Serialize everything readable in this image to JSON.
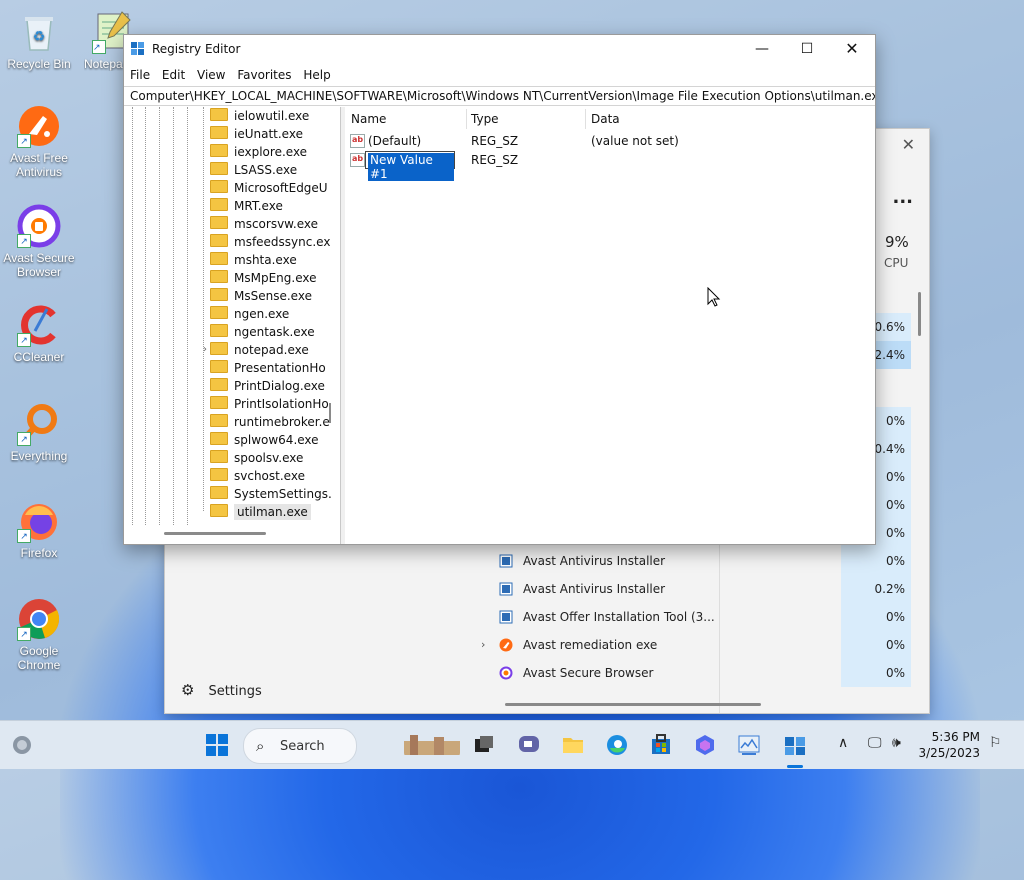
{
  "desktop": {
    "icons": [
      {
        "label": "Recycle Bin",
        "icon": "recycle-bin-icon"
      },
      {
        "label": "Notepa",
        "icon": "notepad-icon"
      },
      {
        "label": "Avast Free Antivirus",
        "icon": "avast-antivirus-icon"
      },
      {
        "label": "Avast Secure Browser",
        "icon": "avast-browser-icon"
      },
      {
        "label": "CCleaner",
        "icon": "ccleaner-icon"
      },
      {
        "label": "Everything",
        "icon": "everything-icon"
      },
      {
        "label": "Firefox",
        "icon": "firefox-icon"
      },
      {
        "label": "Google Chrome",
        "icon": "chrome-icon"
      }
    ]
  },
  "regedit": {
    "title": "Registry Editor",
    "menu": [
      "File",
      "Edit",
      "View",
      "Favorites",
      "Help"
    ],
    "address": "Computer\\HKEY_LOCAL_MACHINE\\SOFTWARE\\Microsoft\\Windows NT\\CurrentVersion\\Image File Execution Options\\utilman.exe",
    "tree": [
      "ielowutil.exe",
      "ieUnatt.exe",
      "iexplore.exe",
      "LSASS.exe",
      "MicrosoftEdgeU",
      "MRT.exe",
      "mscorsvw.exe",
      "msfeedssync.ex",
      "mshta.exe",
      "MsMpEng.exe",
      "MsSense.exe",
      "ngen.exe",
      "ngentask.exe",
      "notepad.exe",
      "PresentationHo",
      "PrintDialog.exe",
      "PrintIsolationHo",
      "runtimebroker.e",
      "splwow64.exe",
      "spoolsv.exe",
      "svchost.exe",
      "SystemSettings.",
      "utilman.exe"
    ],
    "tree_expander": "›",
    "columns": {
      "name": "Name",
      "type": "Type",
      "data": "Data"
    },
    "values": [
      {
        "name": "(Default)",
        "type": "REG_SZ",
        "data": "(value not set)"
      },
      {
        "name": "New Value #1",
        "type": "REG_SZ",
        "data": ""
      }
    ],
    "value_icon_text": "ab"
  },
  "taskmgr": {
    "cpu_percent": "9%",
    "cpu_label": "CPU",
    "more": "...",
    "rows_top": [
      {
        "cpu": "0.6%"
      },
      {
        "cpu": "2.4%"
      },
      {
        "cpu": "0%"
      },
      {
        "cpu": "0.4%"
      },
      {
        "cpu": "0%"
      },
      {
        "cpu": "0%"
      },
      {
        "cpu": "0%"
      }
    ],
    "processes": [
      {
        "name": "Avast Antivirus Installer",
        "cpu": "0%"
      },
      {
        "name": "Avast Antivirus Installer",
        "cpu": "0.2%"
      },
      {
        "name": "Avast Offer Installation Tool (3...",
        "cpu": "0%"
      },
      {
        "name": "Avast remediation exe",
        "cpu": "0%"
      },
      {
        "name": "Avast Secure Browser",
        "cpu": "0%"
      }
    ],
    "settings_label": "Settings"
  },
  "taskbar": {
    "search_label": "Search",
    "time": "5:36 PM",
    "date": "3/25/2023"
  }
}
